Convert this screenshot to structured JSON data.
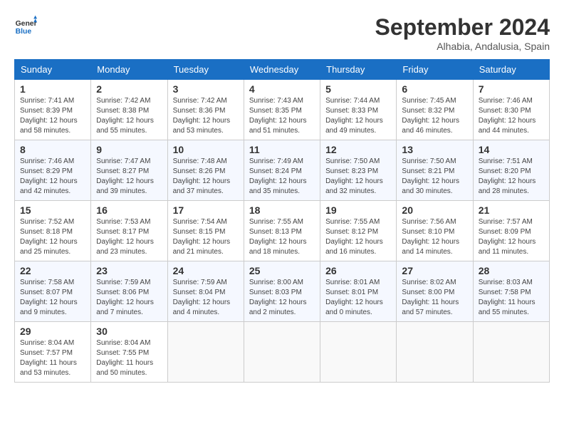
{
  "logo": {
    "text_general": "General",
    "text_blue": "Blue"
  },
  "title": "September 2024",
  "subtitle": "Alhabia, Andalusia, Spain",
  "header": {
    "days": [
      "Sunday",
      "Monday",
      "Tuesday",
      "Wednesday",
      "Thursday",
      "Friday",
      "Saturday"
    ]
  },
  "weeks": [
    {
      "days": [
        {
          "num": "1",
          "rise": "7:41 AM",
          "set": "8:39 PM",
          "daylight": "12 hours and 58 minutes."
        },
        {
          "num": "2",
          "rise": "7:42 AM",
          "set": "8:38 PM",
          "daylight": "12 hours and 55 minutes."
        },
        {
          "num": "3",
          "rise": "7:42 AM",
          "set": "8:36 PM",
          "daylight": "12 hours and 53 minutes."
        },
        {
          "num": "4",
          "rise": "7:43 AM",
          "set": "8:35 PM",
          "daylight": "12 hours and 51 minutes."
        },
        {
          "num": "5",
          "rise": "7:44 AM",
          "set": "8:33 PM",
          "daylight": "12 hours and 49 minutes."
        },
        {
          "num": "6",
          "rise": "7:45 AM",
          "set": "8:32 PM",
          "daylight": "12 hours and 46 minutes."
        },
        {
          "num": "7",
          "rise": "7:46 AM",
          "set": "8:30 PM",
          "daylight": "12 hours and 44 minutes."
        }
      ]
    },
    {
      "days": [
        {
          "num": "8",
          "rise": "7:46 AM",
          "set": "8:29 PM",
          "daylight": "12 hours and 42 minutes."
        },
        {
          "num": "9",
          "rise": "7:47 AM",
          "set": "8:27 PM",
          "daylight": "12 hours and 39 minutes."
        },
        {
          "num": "10",
          "rise": "7:48 AM",
          "set": "8:26 PM",
          "daylight": "12 hours and 37 minutes."
        },
        {
          "num": "11",
          "rise": "7:49 AM",
          "set": "8:24 PM",
          "daylight": "12 hours and 35 minutes."
        },
        {
          "num": "12",
          "rise": "7:50 AM",
          "set": "8:23 PM",
          "daylight": "12 hours and 32 minutes."
        },
        {
          "num": "13",
          "rise": "7:50 AM",
          "set": "8:21 PM",
          "daylight": "12 hours and 30 minutes."
        },
        {
          "num": "14",
          "rise": "7:51 AM",
          "set": "8:20 PM",
          "daylight": "12 hours and 28 minutes."
        }
      ]
    },
    {
      "days": [
        {
          "num": "15",
          "rise": "7:52 AM",
          "set": "8:18 PM",
          "daylight": "12 hours and 25 minutes."
        },
        {
          "num": "16",
          "rise": "7:53 AM",
          "set": "8:17 PM",
          "daylight": "12 hours and 23 minutes."
        },
        {
          "num": "17",
          "rise": "7:54 AM",
          "set": "8:15 PM",
          "daylight": "12 hours and 21 minutes."
        },
        {
          "num": "18",
          "rise": "7:55 AM",
          "set": "8:13 PM",
          "daylight": "12 hours and 18 minutes."
        },
        {
          "num": "19",
          "rise": "7:55 AM",
          "set": "8:12 PM",
          "daylight": "12 hours and 16 minutes."
        },
        {
          "num": "20",
          "rise": "7:56 AM",
          "set": "8:10 PM",
          "daylight": "12 hours and 14 minutes."
        },
        {
          "num": "21",
          "rise": "7:57 AM",
          "set": "8:09 PM",
          "daylight": "12 hours and 11 minutes."
        }
      ]
    },
    {
      "days": [
        {
          "num": "22",
          "rise": "7:58 AM",
          "set": "8:07 PM",
          "daylight": "12 hours and 9 minutes."
        },
        {
          "num": "23",
          "rise": "7:59 AM",
          "set": "8:06 PM",
          "daylight": "12 hours and 7 minutes."
        },
        {
          "num": "24",
          "rise": "7:59 AM",
          "set": "8:04 PM",
          "daylight": "12 hours and 4 minutes."
        },
        {
          "num": "25",
          "rise": "8:00 AM",
          "set": "8:03 PM",
          "daylight": "12 hours and 2 minutes."
        },
        {
          "num": "26",
          "rise": "8:01 AM",
          "set": "8:01 PM",
          "daylight": "12 hours and 0 minutes."
        },
        {
          "num": "27",
          "rise": "8:02 AM",
          "set": "8:00 PM",
          "daylight": "11 hours and 57 minutes."
        },
        {
          "num": "28",
          "rise": "8:03 AM",
          "set": "7:58 PM",
          "daylight": "11 hours and 55 minutes."
        }
      ]
    },
    {
      "days": [
        {
          "num": "29",
          "rise": "8:04 AM",
          "set": "7:57 PM",
          "daylight": "11 hours and 53 minutes."
        },
        {
          "num": "30",
          "rise": "8:04 AM",
          "set": "7:55 PM",
          "daylight": "11 hours and 50 minutes."
        },
        null,
        null,
        null,
        null,
        null
      ]
    }
  ],
  "labels": {
    "sunrise": "Sunrise:",
    "sunset": "Sunset:",
    "daylight": "Daylight:"
  }
}
